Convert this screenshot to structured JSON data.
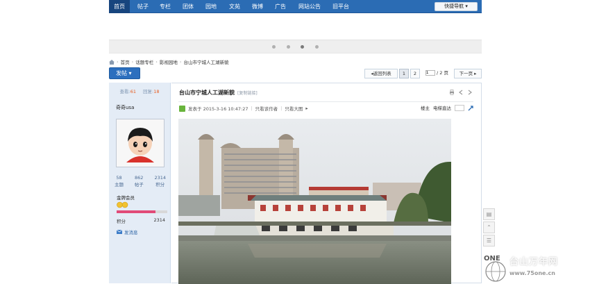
{
  "nav": {
    "items": [
      "首页",
      "帖子",
      "专栏",
      "团体",
      "园地",
      "文苑",
      "微博",
      "广告",
      "网站公告",
      "旧平台"
    ],
    "nav_button": "快捷导航"
  },
  "breadcrumb": {
    "items": [
      "首页",
      "话题专栏",
      "影视园地",
      "台山市宁城人工湖新貌"
    ]
  },
  "toolbar": {
    "post_button": "发帖",
    "back_list": "◂返回列表",
    "page1": "1",
    "page2": "2",
    "page_input": "1",
    "page_total": "/ 2 页",
    "next": "下一页 ▸"
  },
  "sidebar": {
    "views_label": "查看:",
    "views": "61",
    "replies_label": "回复:",
    "replies": "18",
    "username": "奇奇usa",
    "stats": [
      {
        "value": "58",
        "label": "主题"
      },
      {
        "value": "862",
        "label": "帖子"
      },
      {
        "value": "2314",
        "label": "积分"
      }
    ],
    "rank": "金牌会员",
    "points_label": "积分",
    "points": "2314",
    "points_fill": 0.77,
    "send_message": "发消息"
  },
  "post": {
    "title": "台山市宁城人工湖新貌",
    "title_tag": "[复制链接]",
    "posted_on": "发表于 2015-3-16 10:47:27",
    "author_only": "只看该作者",
    "large_image": "只看大图",
    "floor_label": "楼主",
    "jump_label": "电梯直达"
  },
  "watermark": {
    "site_name": "台山万年网",
    "url": "www.75one.cn",
    "logo_text": "ONE"
  },
  "colors": {
    "nav_bg": "#2b6cb4",
    "accent_orange": "#e65b1f",
    "sidebar_bg": "#e4ecf6"
  }
}
